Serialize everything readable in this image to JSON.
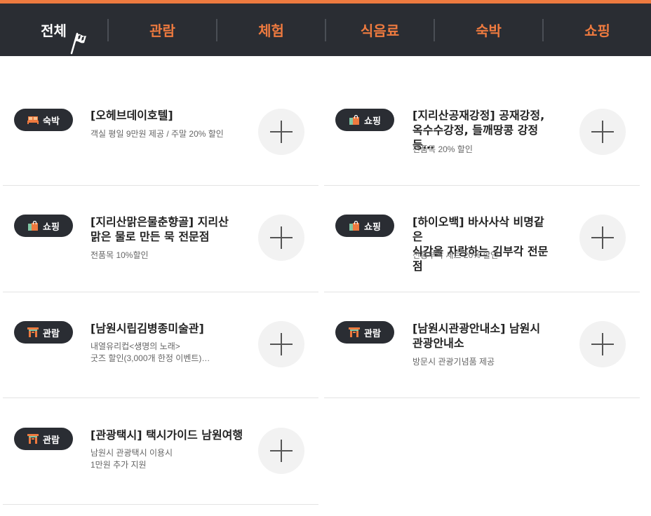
{
  "nav": {
    "tabs": [
      {
        "label": "전체",
        "active": true
      },
      {
        "label": "관람"
      },
      {
        "label": "체험"
      },
      {
        "label": "식음료"
      },
      {
        "label": "숙박"
      },
      {
        "label": "쇼핑"
      }
    ]
  },
  "colors": {
    "accent": "#ee7a3f",
    "dark": "#2a2d33"
  },
  "items": [
    {
      "category": "숙박",
      "icon": "bed-icon",
      "title": "[오헤브데이호텔]",
      "desc": "객실 평일 9만원 제공 / 주말 20% 할인"
    },
    {
      "category": "쇼핑",
      "icon": "shopping-bag-icon",
      "title": "[지리산공재강정] 공재강정,\n옥수수강정, 들깨땅콩 강정 등…",
      "desc": "전품목 20% 할인"
    },
    {
      "category": "쇼핑",
      "icon": "shopping-bag-icon",
      "title": "[지리산맑은물춘향골] 지리산\n맑은 물로 만든 묵 전문점",
      "desc": "전품목 10%할인"
    },
    {
      "category": "쇼핑",
      "icon": "shopping-bag-icon",
      "title": "[하이오백] 바사사삭 비명같은\n식감을 자랑하는 김부각 전문점",
      "desc": "전통부각 세트 20% 할인"
    },
    {
      "category": "관람",
      "icon": "gate-icon",
      "title": "[남원시립김병종미술관]",
      "desc": "내열유리컵<생명의 노래>\n굿즈 할인(3,000개 한정 이벤트)…"
    },
    {
      "category": "관람",
      "icon": "gate-icon",
      "title": "[남원시관광안내소] 남원시\n관광안내소",
      "desc": "방문시 관광기념품 제공"
    },
    {
      "category": "관람",
      "icon": "gate-icon",
      "title": "[관광택시] 택시가이드 남원여행",
      "desc": "남원시 관광택시 이용시\n1만원 추가 지원"
    }
  ]
}
